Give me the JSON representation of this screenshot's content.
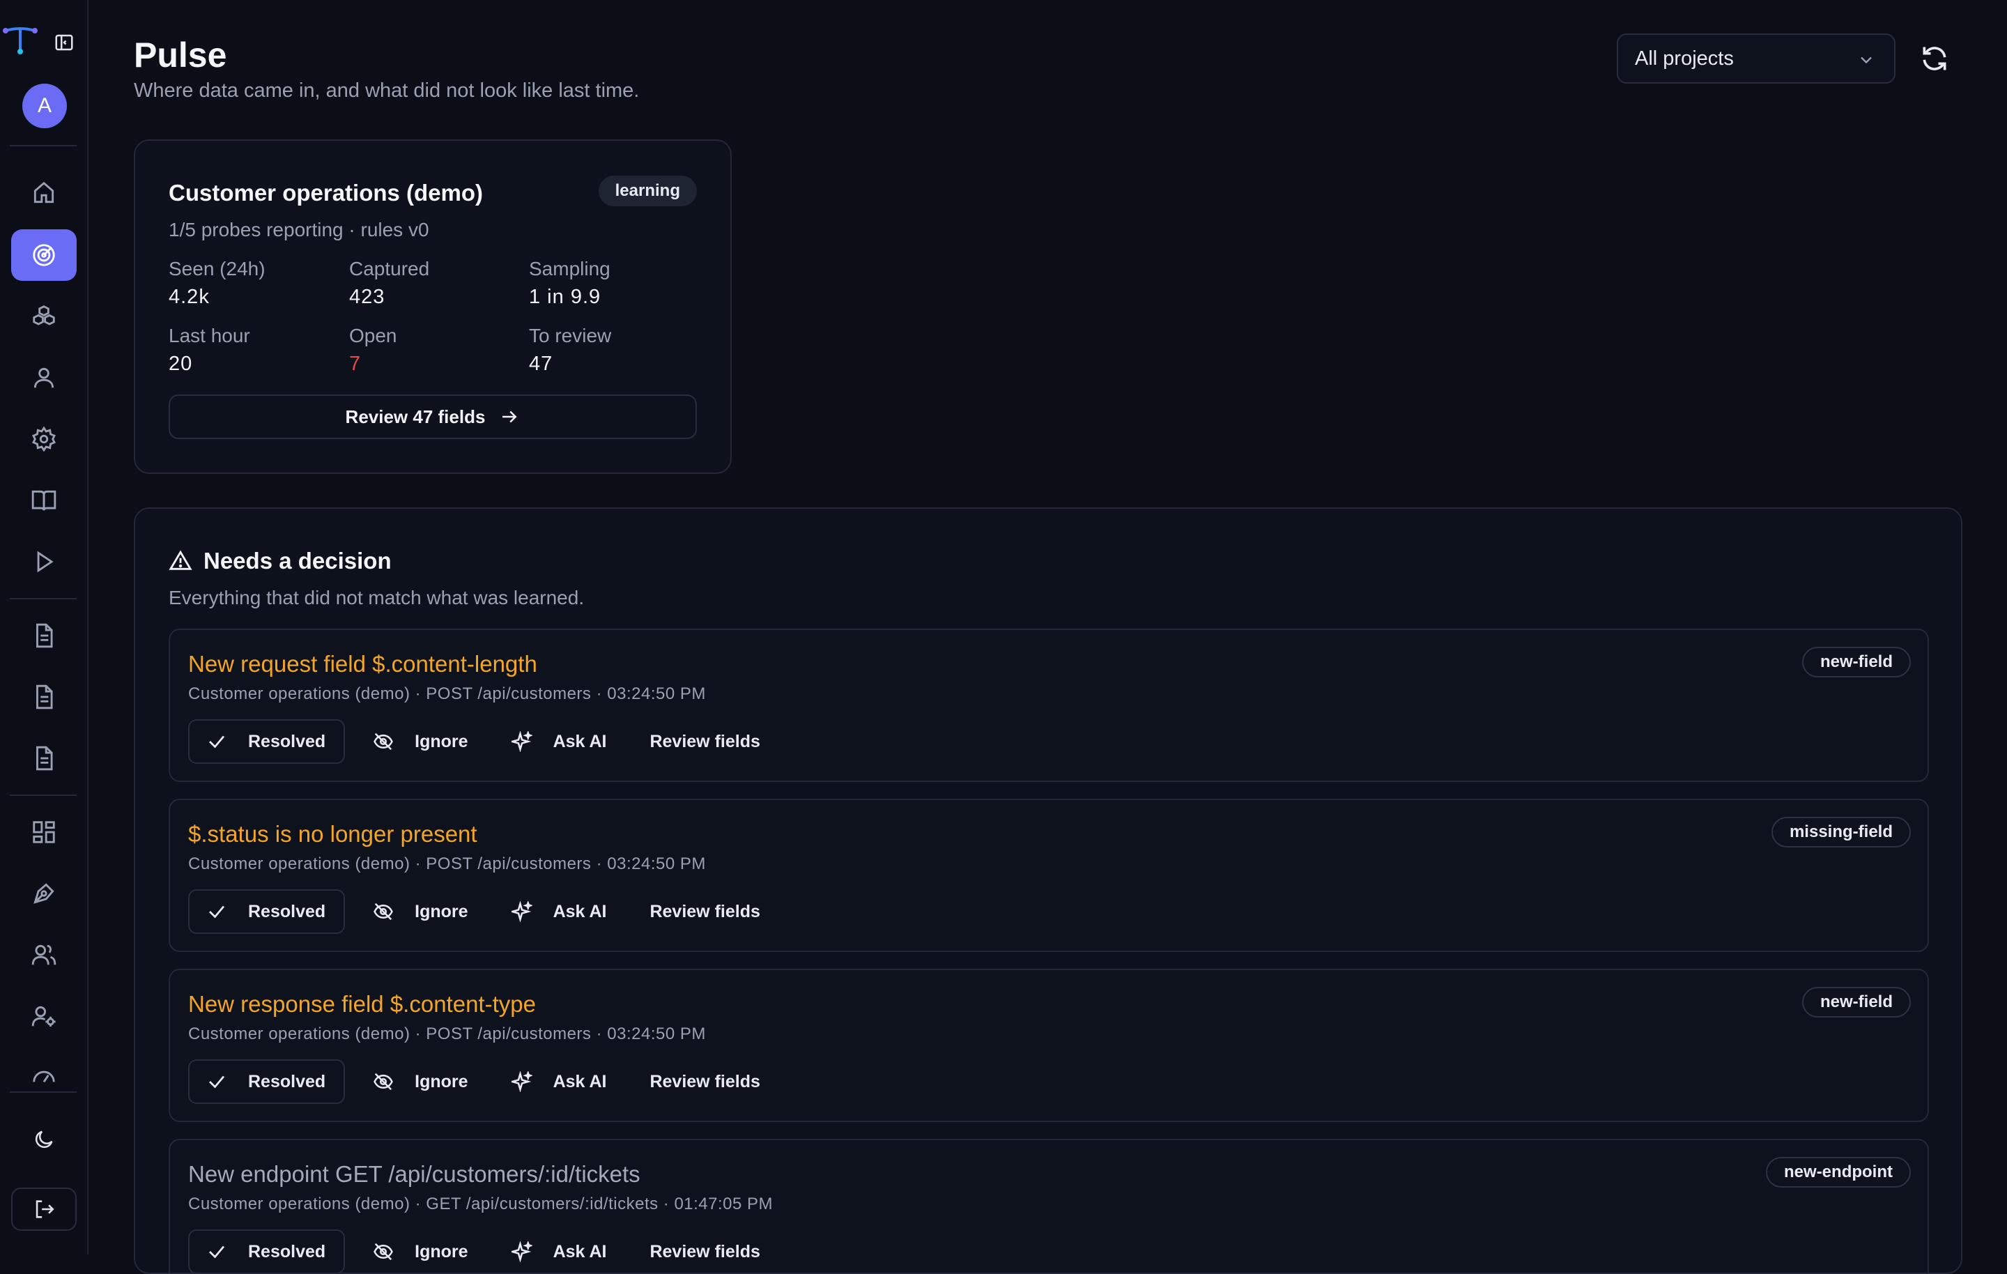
{
  "sidebar": {
    "avatar_initial": "A",
    "nav_items": [
      {
        "name": "home",
        "icon": "home-icon",
        "active": false
      },
      {
        "name": "pulse",
        "icon": "radar-icon",
        "active": true
      },
      {
        "name": "components",
        "icon": "boxes-icon",
        "active": false
      },
      {
        "name": "profile",
        "icon": "user-icon",
        "active": false
      },
      {
        "name": "settings",
        "icon": "gear-icon",
        "active": false
      },
      {
        "name": "docs",
        "icon": "book-icon",
        "active": false
      },
      {
        "name": "run",
        "icon": "play-icon",
        "active": false
      },
      {
        "name": "report-1",
        "icon": "document-icon",
        "active": false
      },
      {
        "name": "report-2",
        "icon": "document-icon",
        "active": false
      },
      {
        "name": "report-3",
        "icon": "document-icon",
        "active": false
      },
      {
        "name": "dashboard",
        "icon": "grid-icon",
        "active": false
      },
      {
        "name": "design",
        "icon": "pen-icon",
        "active": false
      },
      {
        "name": "team",
        "icon": "users-icon",
        "active": false
      },
      {
        "name": "user-settings",
        "icon": "user-gear-icon",
        "active": false
      },
      {
        "name": "speed",
        "icon": "gauge-icon",
        "active": false
      }
    ]
  },
  "header": {
    "title": "Pulse",
    "subtitle": "Where data came in, and what did not look like last time.",
    "project_select": "All projects"
  },
  "project_card": {
    "title": "Customer operations (demo)",
    "badge": "learning",
    "subtitle": "1/5 probes reporting · rules v0",
    "stats": [
      {
        "label": "Seen (24h)",
        "value": "4.2k"
      },
      {
        "label": "Captured",
        "value": "423"
      },
      {
        "label": "Sampling",
        "value": "1 in 9.9"
      },
      {
        "label": "Last hour",
        "value": "20"
      },
      {
        "label": "Open",
        "value": "7"
      },
      {
        "label": "To review",
        "value": "47"
      }
    ],
    "review_button": "Review 47 fields"
  },
  "decisions": {
    "title": "Needs a decision",
    "subtitle": "Everything that did not match what was learned.",
    "action_labels": {
      "resolved": "Resolved",
      "ignore": "Ignore",
      "ask_ai": "Ask AI",
      "review": "Review fields"
    },
    "issues": [
      {
        "title": "New request field $.content-length",
        "meta": "Customer operations (demo) · POST /api/customers · 03:24:50 PM",
        "tag": "new-field"
      },
      {
        "title": "$.status is no longer present",
        "meta": "Customer operations (demo) · POST /api/customers · 03:24:50 PM",
        "tag": "missing-field"
      },
      {
        "title": "New response field $.content-type",
        "meta": "Customer operations (demo) · POST /api/customers · 03:24:50 PM",
        "tag": "new-field"
      },
      {
        "title": "New endpoint GET /api/customers/:id/tickets",
        "meta": "Customer operations (demo) · GET /api/customers/:id/tickets · 01:47:05 PM",
        "tag": "new-endpoint"
      }
    ]
  },
  "colors": {
    "accent": "#6b6cf6",
    "warning": "#f5a524",
    "danger": "#e5484d",
    "background": "#0b0e17"
  }
}
